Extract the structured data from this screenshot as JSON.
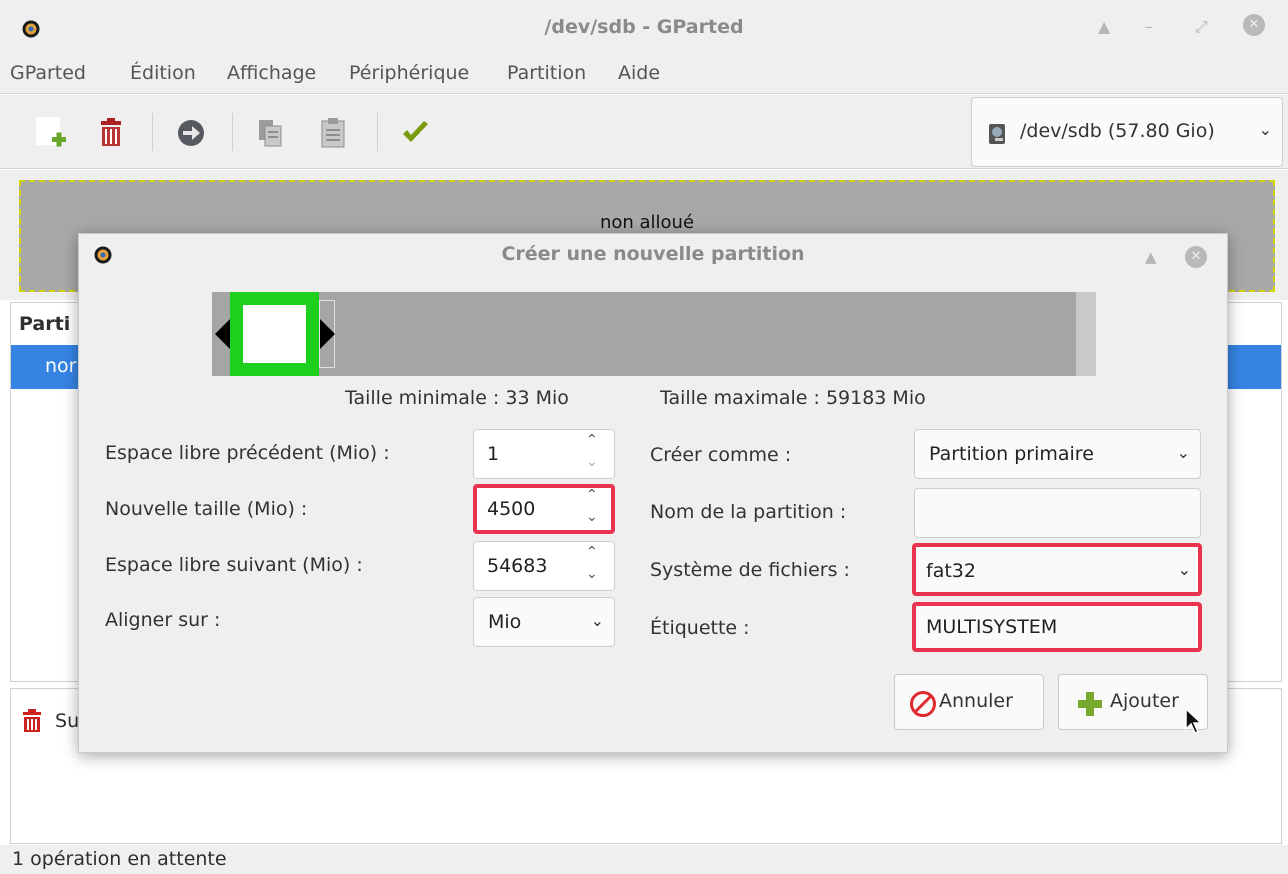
{
  "window": {
    "title": "/dev/sdb - GParted",
    "controls": [
      "▲",
      "–",
      "⤢",
      "✕"
    ]
  },
  "menu": [
    "GParted",
    "Édition",
    "Affichage",
    "Périphérique",
    "Partition",
    "Aide"
  ],
  "toolbar": {
    "icons": [
      "new-partition-icon",
      "delete-icon",
      "apply-arrow-icon",
      "copy-icon",
      "paste-icon",
      "apply-check-icon"
    ],
    "device": "/dev/sdb  (57.80 Gio)"
  },
  "graph": {
    "unallocated_label": "non alloué"
  },
  "partition_list": {
    "header": "Parti",
    "row_text": "nor"
  },
  "operations": {
    "first_row": "Su"
  },
  "status": {
    "text": "1 opération en attente"
  },
  "dialog": {
    "title": "Créer une nouvelle partition",
    "min_size": "Taille minimale : 33 Mio",
    "max_size": "Taille maximale : 59183 Mio",
    "left": {
      "free_before_label": "Espace libre précédent (Mio) :",
      "free_before_value": "1",
      "new_size_label": "Nouvelle taille (Mio) :",
      "new_size_value": "4500",
      "free_after_label": "Espace libre suivant (Mio) :",
      "free_after_value": "54683",
      "align_label": "Aligner sur :",
      "align_value": "Mio"
    },
    "right": {
      "create_as_label": "Créer comme :",
      "create_as_value": "Partition primaire",
      "name_label": "Nom de la partition :",
      "name_value": "",
      "fs_label": "Système de fichiers :",
      "fs_value": "fat32",
      "label_label": "Étiquette :",
      "label_value": "MULTISYSTEM"
    },
    "cancel": "Annuler",
    "add": "Ajouter"
  }
}
